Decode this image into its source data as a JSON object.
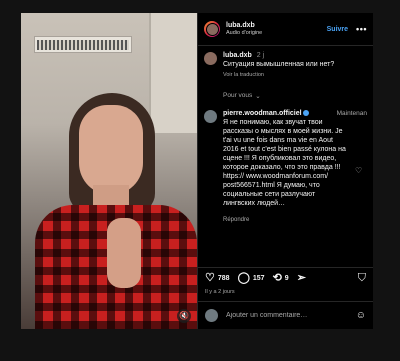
{
  "header": {
    "username": "luba.dxb",
    "audio": "Audio d'origine",
    "follow_label": "Suivre",
    "more_label": "•••"
  },
  "caption": {
    "username": "luba.dxb",
    "time": "2 j",
    "text": "Ситуация вымышленная или нет?",
    "translate_label": "Voir la traduction"
  },
  "for_you_label": "Pour vous",
  "comment": {
    "username": "pierre.woodman.officiel",
    "time": "Maintenan",
    "text": "Я не понимаю, как звучат твои рассказы о мыслях в моей жизни. Je t'ai vu une fois dans ma vie en Aout 2016 et tout c'est bien passé кулона на сцене !!! Я опубликовал это видео, которое доказало, что это правда !!! https:// www.woodmanforum.com/ post566571.html Я думаю, что социальные сети разлучают лингвских людей…",
    "reply_label": "Répondre"
  },
  "actions": {
    "likes": "788",
    "comments": "157",
    "shares": "9"
  },
  "date_label": "Il y a 2 jours",
  "composer": {
    "placeholder": "Ajouter un commentaire…"
  },
  "icons": {
    "heart": "heart-icon",
    "comment": "comment-icon",
    "repost": "repost-icon",
    "share": "send-icon",
    "bookmark": "bookmark-icon",
    "emoji": "emoji-icon",
    "mute": "muted-speaker-icon"
  },
  "colors": {
    "accent": "#4aa3f5",
    "background": "#000000",
    "muted_text": "#a8a8a8"
  }
}
